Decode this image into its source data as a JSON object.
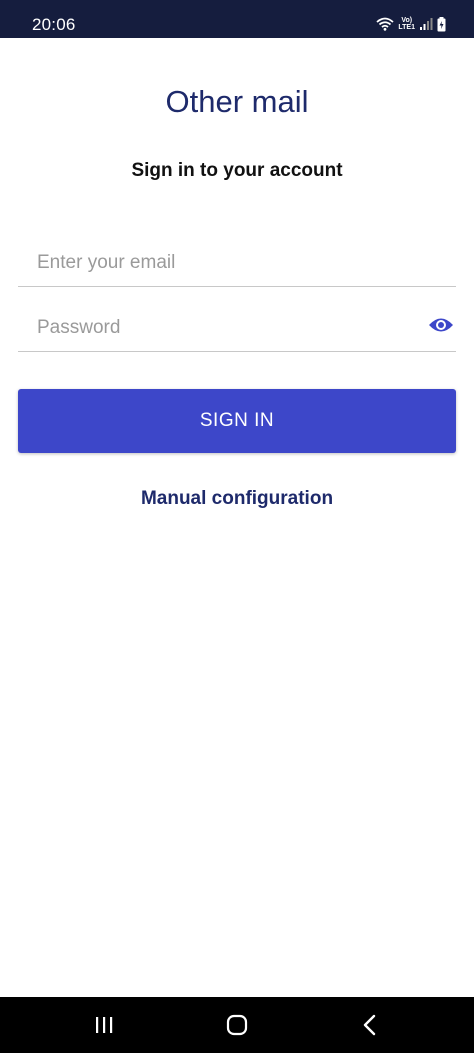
{
  "status_bar": {
    "time": "20:06",
    "icons": [
      "wifi-icon",
      "volte-lte-icon",
      "signal-icon",
      "battery-icon"
    ],
    "volte_top": "Vo)",
    "volte_bottom": "LTE1"
  },
  "header": {
    "title": "Other mail",
    "subtitle": "Sign in to your account"
  },
  "form": {
    "email_placeholder": "Enter your email",
    "email_value": "",
    "password_placeholder": "Password",
    "password_value": "",
    "sign_in_label": "SIGN IN",
    "manual_config_label": "Manual configuration"
  },
  "nav_bar": {
    "buttons": [
      "recents-icon",
      "home-icon",
      "back-icon"
    ]
  },
  "colors": {
    "status_bar": "#151d3e",
    "accent": "#3d47c9",
    "title": "#1e2a6b"
  }
}
